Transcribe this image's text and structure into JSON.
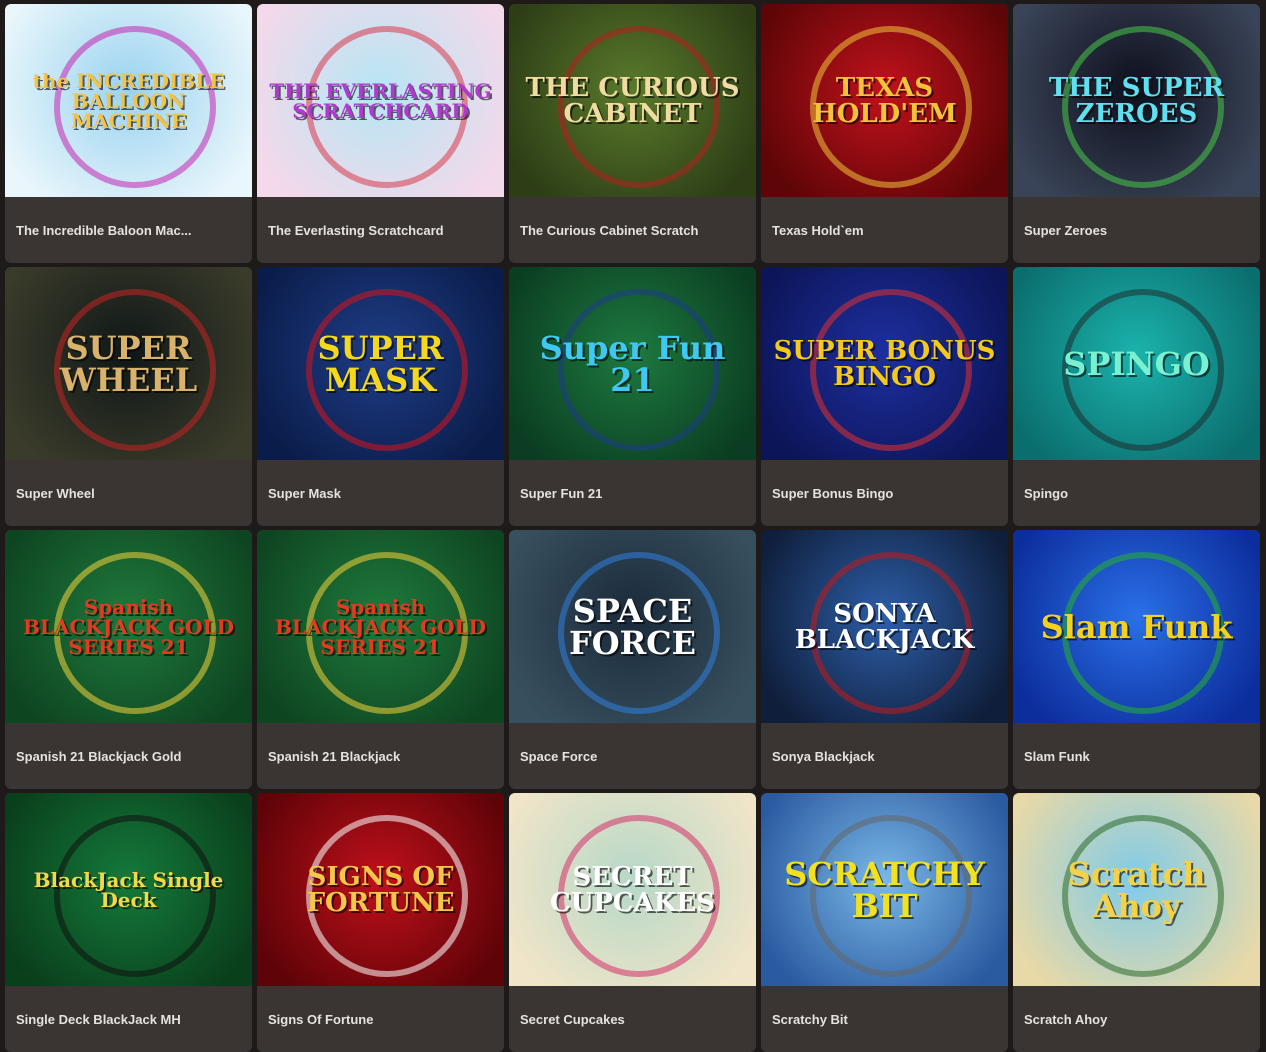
{
  "games": [
    {
      "title": "The Incredible Baloon Mac...",
      "logo": "the INCREDIBLE BALLOON MACHINE",
      "bg1": "#9ad3f0",
      "bg2": "#e9f6fb",
      "logo_color": "#f2c34a",
      "accent": "#c724b3"
    },
    {
      "title": "The Everlasting Scratchcard",
      "logo": "THE EVERLASTING SCRATCHCARD",
      "bg1": "#b6e6f4",
      "bg2": "#f3d9ea",
      "logo_color": "#b03ad0",
      "accent": "#d8384a"
    },
    {
      "title": "The Curious Cabinet Scratch",
      "logo": "THE CURIOUS CABINET",
      "bg1": "#5a7a2b",
      "bg2": "#2d3d16",
      "logo_color": "#f0dca0",
      "accent": "#b31f1f"
    },
    {
      "title": "Texas Hold`em",
      "logo": "TEXAS HOLD'EM",
      "bg1": "#c1121b",
      "bg2": "#5d0507",
      "logo_color": "#f3c23b",
      "accent": "#f3c23b"
    },
    {
      "title": "Super Zeroes",
      "logo": "THE SUPER ZEROES",
      "bg1": "#0d0f1c",
      "bg2": "#3a4458",
      "logo_color": "#5fe0f0",
      "accent": "#49c948"
    },
    {
      "title": "Super Wheel",
      "logo": "SUPER WHEEL",
      "bg1": "#0f1717",
      "bg2": "#3a3b2a",
      "logo_color": "#d9b26c",
      "accent": "#c42323"
    },
    {
      "title": "Super Mask",
      "logo": "SUPER MASK",
      "bg1": "#1f3d87",
      "bg2": "#0a1c49",
      "logo_color": "#f3d81e",
      "accent": "#d8121a"
    },
    {
      "title": "Super Fun 21",
      "logo": "Super Fun 21",
      "bg1": "#1d7a3f",
      "bg2": "#0b3d22",
      "logo_color": "#3ec8f2",
      "accent": "#1e3a8a"
    },
    {
      "title": "Super Bonus Bingo",
      "logo": "SUPER BONUS BINGO",
      "bg1": "#1d2fa0",
      "bg2": "#0c1557",
      "logo_color": "#f3c91f",
      "accent": "#e23030"
    },
    {
      "title": "Spingo",
      "logo": "SPINGO",
      "bg1": "#1bb3ad",
      "bg2": "#0b6e6e",
      "logo_color": "#7af0d3",
      "accent": "#1d2d2d"
    },
    {
      "title": "Spanish 21 Blackjack Gold",
      "logo": "Spanish BLACKJACK GOLD SERIES 21",
      "bg1": "#1f7a3c",
      "bg2": "#0e4521",
      "logo_color": "#e23b1f",
      "accent": "#f3d43a"
    },
    {
      "title": "Spanish 21 Blackjack",
      "logo": "Spanish BLACKJACK GOLD SERIES 21",
      "bg1": "#1f7a3c",
      "bg2": "#0e4521",
      "logo_color": "#e23b1f",
      "accent": "#f3d43a"
    },
    {
      "title": "Space Force",
      "logo": "SPACE FORCE",
      "bg1": "#1a2a3a",
      "bg2": "#38505e",
      "logo_color": "#ffffff",
      "accent": "#2f7fe0"
    },
    {
      "title": "Sonya Blackjack",
      "logo": "SONYA BLACKJACK",
      "bg1": "#2d5ea8",
      "bg2": "#0f1e3a",
      "logo_color": "#ffffff",
      "accent": "#c21919"
    },
    {
      "title": "Slam Funk",
      "logo": "Slam Funk",
      "bg1": "#2a70e8",
      "bg2": "#0c2d9c",
      "logo_color": "#f3d11f",
      "accent": "#27b32a"
    },
    {
      "title": "Single Deck BlackJack MH",
      "logo": "BlackJack Single Deck",
      "bg1": "#147a3a",
      "bg2": "#0a3f1c",
      "logo_color": "#f3d84a",
      "accent": "#111111"
    },
    {
      "title": "Signs Of Fortune",
      "logo": "SIGNS OF FORTUNE",
      "bg1": "#c1101a",
      "bg2": "#5e0308",
      "logo_color": "#f3c74a",
      "accent": "#ffffff"
    },
    {
      "title": "Secret Cupcakes",
      "logo": "SECRET CUPCAKES",
      "bg1": "#b6d8c8",
      "bg2": "#f0e5c8",
      "logo_color": "#ffffff",
      "accent": "#d33069"
    },
    {
      "title": "Scratchy Bit",
      "logo": "SCRATCHY BIT",
      "bg1": "#7ab8e8",
      "bg2": "#2a5aa0",
      "logo_color": "#f3e01f",
      "accent": "#666666"
    },
    {
      "title": "Scratch Ahoy",
      "logo": "Scratch Ahoy",
      "bg1": "#7fcbe8",
      "bg2": "#e8d9a8",
      "logo_color": "#f3d24a",
      "accent": "#2a6a2a"
    }
  ]
}
